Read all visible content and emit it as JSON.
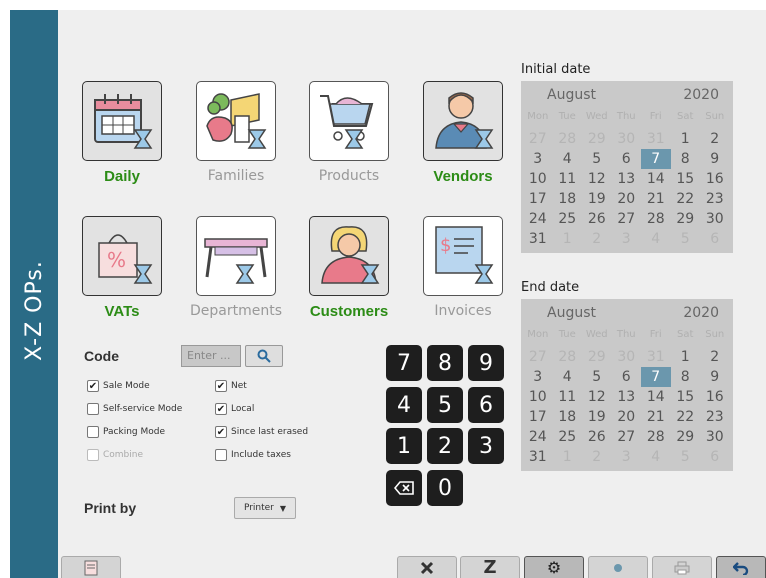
{
  "sidebar": {
    "title": "X-Z OPs."
  },
  "tiles": [
    {
      "label": "Daily",
      "active": true
    },
    {
      "label": "Families",
      "active": false
    },
    {
      "label": "Products",
      "active": false
    },
    {
      "label": "Vendors",
      "active": true
    },
    {
      "label": "VATs",
      "active": true
    },
    {
      "label": "Departments",
      "active": false
    },
    {
      "label": "Customers",
      "active": true
    },
    {
      "label": "Invoices",
      "active": false
    }
  ],
  "calendars": {
    "initial": {
      "title": "Initial date",
      "month": "August",
      "year": "2020",
      "weekdays": [
        "Mon",
        "Tue",
        "Wed",
        "Thu",
        "Fri",
        "Sat",
        "Sun"
      ],
      "days": [
        [
          "27",
          "other"
        ],
        [
          "28",
          "other"
        ],
        [
          "29",
          "other"
        ],
        [
          "30",
          "other"
        ],
        [
          "31",
          "other"
        ],
        [
          "1",
          ""
        ],
        [
          "2",
          ""
        ],
        [
          "3",
          ""
        ],
        [
          "4",
          ""
        ],
        [
          "5",
          ""
        ],
        [
          "6",
          ""
        ],
        [
          "7",
          "sel"
        ],
        [
          "8",
          ""
        ],
        [
          "9",
          ""
        ],
        [
          "10",
          ""
        ],
        [
          "11",
          ""
        ],
        [
          "12",
          ""
        ],
        [
          "13",
          ""
        ],
        [
          "14",
          ""
        ],
        [
          "15",
          ""
        ],
        [
          "16",
          ""
        ],
        [
          "17",
          ""
        ],
        [
          "18",
          ""
        ],
        [
          "19",
          ""
        ],
        [
          "20",
          ""
        ],
        [
          "21",
          ""
        ],
        [
          "22",
          ""
        ],
        [
          "23",
          ""
        ],
        [
          "24",
          ""
        ],
        [
          "25",
          ""
        ],
        [
          "26",
          ""
        ],
        [
          "27",
          ""
        ],
        [
          "28",
          ""
        ],
        [
          "29",
          ""
        ],
        [
          "30",
          ""
        ],
        [
          "31",
          ""
        ],
        [
          "1",
          "other"
        ],
        [
          "2",
          "other"
        ],
        [
          "3",
          "other"
        ],
        [
          "4",
          "other"
        ],
        [
          "5",
          "other"
        ],
        [
          "6",
          "other"
        ]
      ]
    },
    "end": {
      "title": "End date",
      "month": "August",
      "year": "2020",
      "weekdays": [
        "Mon",
        "Tue",
        "Wed",
        "Thu",
        "Fri",
        "Sat",
        "Sun"
      ],
      "days": [
        [
          "27",
          "other"
        ],
        [
          "28",
          "other"
        ],
        [
          "29",
          "other"
        ],
        [
          "30",
          "other"
        ],
        [
          "31",
          "other"
        ],
        [
          "1",
          ""
        ],
        [
          "2",
          ""
        ],
        [
          "3",
          ""
        ],
        [
          "4",
          ""
        ],
        [
          "5",
          ""
        ],
        [
          "6",
          ""
        ],
        [
          "7",
          "sel"
        ],
        [
          "8",
          ""
        ],
        [
          "9",
          ""
        ],
        [
          "10",
          ""
        ],
        [
          "11",
          ""
        ],
        [
          "12",
          ""
        ],
        [
          "13",
          ""
        ],
        [
          "14",
          ""
        ],
        [
          "15",
          ""
        ],
        [
          "16",
          ""
        ],
        [
          "17",
          ""
        ],
        [
          "18",
          ""
        ],
        [
          "19",
          ""
        ],
        [
          "20",
          ""
        ],
        [
          "21",
          ""
        ],
        [
          "22",
          ""
        ],
        [
          "23",
          ""
        ],
        [
          "24",
          ""
        ],
        [
          "25",
          ""
        ],
        [
          "26",
          ""
        ],
        [
          "27",
          ""
        ],
        [
          "28",
          ""
        ],
        [
          "29",
          ""
        ],
        [
          "30",
          ""
        ],
        [
          "31",
          ""
        ],
        [
          "1",
          "other"
        ],
        [
          "2",
          "other"
        ],
        [
          "3",
          "other"
        ],
        [
          "4",
          "other"
        ],
        [
          "5",
          "other"
        ],
        [
          "6",
          "other"
        ]
      ]
    }
  },
  "code": {
    "label": "Code",
    "placeholder": "Enter ..."
  },
  "options": {
    "sale_mode": {
      "label": "Sale Mode",
      "checked": true
    },
    "self_service_mode": {
      "label": "Self-service Mode",
      "checked": false
    },
    "packing_mode": {
      "label": "Packing Mode",
      "checked": false
    },
    "combine": {
      "label": "Combine",
      "checked": false
    },
    "net": {
      "label": "Net",
      "checked": true
    },
    "local": {
      "label": "Local",
      "checked": true
    },
    "since_last_erased": {
      "label": "Since last erased",
      "checked": true
    },
    "include_taxes": {
      "label": "Include taxes",
      "checked": false
    }
  },
  "print_by": {
    "label": "Print by",
    "value": "Printer"
  },
  "keypad": [
    "7",
    "8",
    "9",
    "4",
    "5",
    "6",
    "1",
    "2",
    "3",
    "0"
  ],
  "toolbar": {
    "icons": [
      "report-icon",
      "close-icon",
      "z-report-icon",
      "gear-icon",
      "preview-icon",
      "printer-icon",
      "back-icon"
    ],
    "z_label": "Z"
  },
  "colors": {
    "sidebar": "#2a6b86",
    "active_label": "#2c8c16",
    "selected_day": "#6b97ad"
  }
}
